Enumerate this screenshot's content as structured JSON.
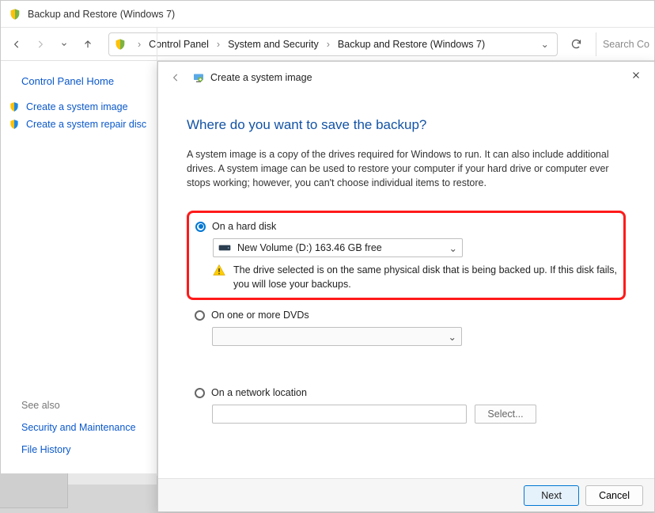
{
  "window": {
    "title": "Backup and Restore (Windows 7)"
  },
  "breadcrumb": {
    "items": [
      "Control Panel",
      "System and Security",
      "Backup and Restore (Windows 7)"
    ]
  },
  "search": {
    "placeholder": "Search Co"
  },
  "leftpane": {
    "home": "Control Panel Home",
    "links": [
      {
        "label": "Create a system image"
      },
      {
        "label": "Create a system repair disc"
      }
    ],
    "see_also_label": "See also",
    "see_also": [
      {
        "label": "Security and Maintenance"
      },
      {
        "label": "File History"
      }
    ]
  },
  "wizard": {
    "title": "Create a system image",
    "heading": "Where do you want to save the backup?",
    "description": "A system image is a copy of the drives required for Windows to run. It can also include additional drives. A system image can be used to restore your computer if your hard drive or computer ever stops working; however, you can't choose individual items to restore.",
    "options": {
      "hard_disk": {
        "label": "On a hard disk",
        "drive_text": "New Volume (D:)  163.46 GB free",
        "warning": "The drive selected is on the same physical disk that is being backed up. If this disk fails, you will lose your backups."
      },
      "dvd": {
        "label": "On one or more DVDs"
      },
      "network": {
        "label": "On a network location",
        "button": "Select..."
      }
    },
    "buttons": {
      "next": "Next",
      "cancel": "Cancel"
    }
  }
}
